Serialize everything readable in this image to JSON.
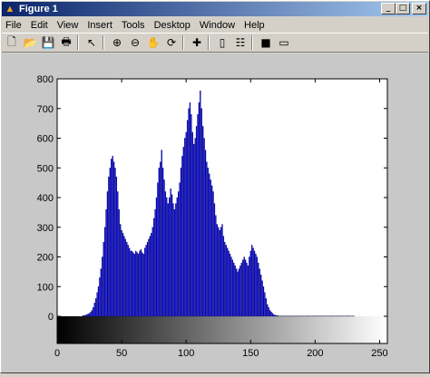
{
  "window": {
    "title": "Figure 1",
    "app_icon": "matlab-logo-icon",
    "minimize_glyph": "_",
    "maximize_glyph": "□",
    "close_glyph": "×"
  },
  "menu": [
    "File",
    "Edit",
    "View",
    "Insert",
    "Tools",
    "Desktop",
    "Window",
    "Help"
  ],
  "toolbar": [
    {
      "name": "new-figure-icon",
      "glyph": "🗋"
    },
    {
      "name": "open-file-icon",
      "glyph": "📂"
    },
    {
      "name": "save-icon",
      "glyph": "💾"
    },
    {
      "name": "print-icon",
      "glyph": "🖶"
    },
    {
      "sep": true
    },
    {
      "name": "edit-plot-arrow-icon",
      "glyph": "↖"
    },
    {
      "sep": true
    },
    {
      "name": "zoom-in-icon",
      "glyph": "⊕"
    },
    {
      "name": "zoom-out-icon",
      "glyph": "⊖"
    },
    {
      "name": "pan-hand-icon",
      "glyph": "✋"
    },
    {
      "name": "rotate-3d-icon",
      "glyph": "⟳"
    },
    {
      "sep": true
    },
    {
      "name": "data-cursor-icon",
      "glyph": "✚"
    },
    {
      "sep": true
    },
    {
      "name": "colorbar-icon",
      "glyph": "▯"
    },
    {
      "name": "legend-icon",
      "glyph": "☷"
    },
    {
      "sep": true
    },
    {
      "name": "hide-plot-tools-icon",
      "glyph": "■"
    },
    {
      "name": "show-plot-tools-icon",
      "glyph": "▭"
    }
  ],
  "chart_data": {
    "type": "bar",
    "title": "",
    "xlabel": "",
    "ylabel": "",
    "xlim": [
      0,
      255
    ],
    "ylim": [
      0,
      800
    ],
    "xticks": [
      0,
      50,
      100,
      150,
      200,
      250
    ],
    "yticks": [
      0,
      100,
      200,
      300,
      400,
      500,
      600,
      700,
      800
    ],
    "grid": false,
    "bar_color": "#0000ff",
    "colorbar": "grayscale 0-255 under x axis",
    "x": [
      20,
      21,
      22,
      23,
      24,
      25,
      26,
      27,
      28,
      29,
      30,
      31,
      32,
      33,
      34,
      35,
      36,
      37,
      38,
      39,
      40,
      41,
      42,
      43,
      44,
      45,
      46,
      47,
      48,
      49,
      50,
      51,
      52,
      53,
      54,
      55,
      56,
      57,
      58,
      59,
      60,
      61,
      62,
      63,
      64,
      65,
      66,
      67,
      68,
      69,
      70,
      71,
      72,
      73,
      74,
      75,
      76,
      77,
      78,
      79,
      80,
      81,
      82,
      83,
      84,
      85,
      86,
      87,
      88,
      89,
      90,
      91,
      92,
      93,
      94,
      95,
      96,
      97,
      98,
      99,
      100,
      101,
      102,
      103,
      104,
      105,
      106,
      107,
      108,
      109,
      110,
      111,
      112,
      113,
      114,
      115,
      116,
      117,
      118,
      119,
      120,
      121,
      122,
      123,
      124,
      125,
      126,
      127,
      128,
      129,
      130,
      131,
      132,
      133,
      134,
      135,
      136,
      137,
      138,
      139,
      140,
      141,
      142,
      143,
      144,
      145,
      146,
      147,
      148,
      149,
      150,
      151,
      152,
      153,
      154,
      155,
      156,
      157,
      158,
      159,
      160,
      161,
      162,
      163,
      164,
      165,
      166,
      167,
      168,
      169,
      170,
      171,
      172,
      173,
      174,
      175,
      176,
      177,
      178,
      179,
      180,
      181,
      182,
      183,
      184,
      185,
      186,
      187,
      188,
      189,
      190,
      191,
      192,
      193,
      194,
      195,
      196,
      197,
      198,
      199,
      200,
      201,
      202,
      203,
      204,
      205,
      206,
      207,
      208,
      209,
      210,
      211,
      212,
      213,
      214,
      215,
      216,
      217,
      218,
      219,
      220,
      221,
      222,
      223,
      224,
      225,
      226,
      227,
      228,
      229,
      230
    ],
    "values": [
      2,
      3,
      4,
      6,
      8,
      10,
      14,
      20,
      30,
      45,
      60,
      80,
      100,
      130,
      160,
      200,
      250,
      300,
      360,
      420,
      470,
      500,
      530,
      540,
      520,
      500,
      470,
      420,
      360,
      310,
      290,
      280,
      270,
      260,
      250,
      240,
      230,
      220,
      220,
      215,
      210,
      220,
      215,
      210,
      220,
      225,
      215,
      210,
      230,
      240,
      250,
      260,
      270,
      280,
      300,
      330,
      360,
      400,
      450,
      500,
      520,
      560,
      500,
      460,
      420,
      400,
      380,
      400,
      430,
      410,
      380,
      360,
      380,
      400,
      420,
      450,
      500,
      540,
      570,
      600,
      620,
      660,
      700,
      720,
      680,
      620,
      580,
      600,
      640,
      680,
      720,
      760,
      700,
      640,
      600,
      560,
      520,
      500,
      480,
      460,
      440,
      420,
      380,
      340,
      310,
      300,
      290,
      300,
      310,
      270,
      250,
      240,
      230,
      220,
      210,
      200,
      190,
      180,
      170,
      160,
      150,
      160,
      170,
      180,
      190,
      200,
      190,
      180,
      170,
      200,
      220,
      240,
      230,
      220,
      210,
      200,
      180,
      160,
      140,
      120,
      100,
      80,
      60,
      40,
      30,
      20,
      15,
      10,
      6,
      4,
      3,
      2,
      1,
      1,
      1,
      1,
      1,
      1,
      1,
      1,
      1,
      1,
      1,
      1,
      1,
      1,
      1,
      1,
      1,
      1,
      1,
      1,
      1,
      1,
      1,
      1,
      1,
      1,
      1,
      1,
      1,
      1,
      1,
      1,
      1,
      1,
      1,
      1,
      1,
      1,
      1,
      1,
      1,
      1,
      1,
      1,
      1,
      1,
      1,
      1,
      1,
      1,
      1,
      1,
      1,
      1,
      1,
      1,
      1,
      1,
      1,
      1,
      1,
      1,
      1
    ]
  }
}
